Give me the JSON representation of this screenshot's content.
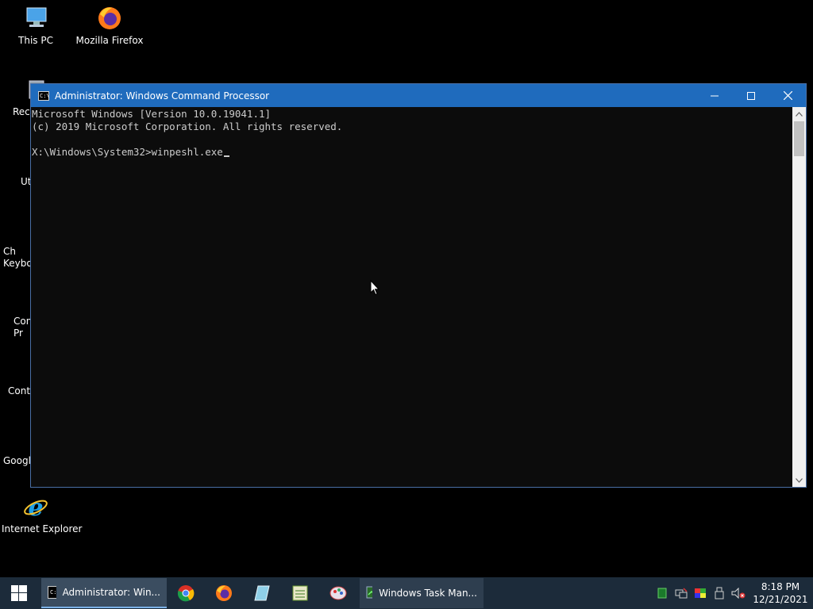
{
  "desktop": {
    "icons": [
      {
        "label": "This PC"
      },
      {
        "label": "Mozilla Firefox"
      },
      {
        "label": "Recy"
      },
      {
        "label": "Ut"
      },
      {
        "label": "Ch\nKeyboa"
      },
      {
        "label": "Con\nPr"
      },
      {
        "label": "Contr"
      },
      {
        "label": "Googl"
      },
      {
        "label": "Internet Explorer"
      }
    ]
  },
  "window": {
    "title": "Administrator: Windows Command Processor",
    "icon_text": "C:\\",
    "console_lines": [
      "Microsoft Windows [Version 10.0.19041.1]",
      "(c) 2019 Microsoft Corporation. All rights reserved.",
      "",
      "X:\\Windows\\System32>winpeshl.exe"
    ]
  },
  "taskbar": {
    "active_task": "Administrator: Win...",
    "task_manager": "Windows Task Man...",
    "clock_time": "8:18 PM",
    "clock_date": "12/21/2021"
  },
  "colors": {
    "titlebar": "#1f6bbd",
    "console_bg": "#0c0c0c",
    "taskbar": "#1c2b3a"
  }
}
